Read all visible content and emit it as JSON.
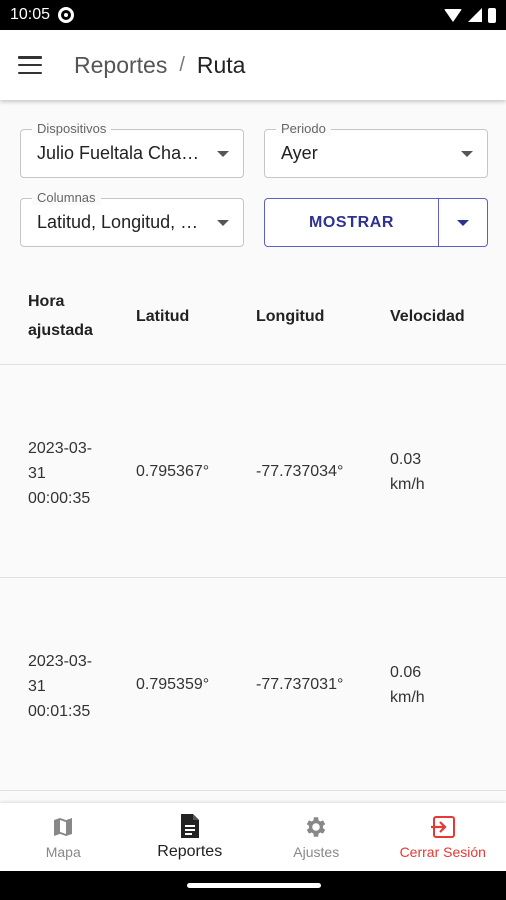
{
  "status_bar": {
    "time": "10:05"
  },
  "breadcrumb": {
    "parent": "Reportes",
    "separator": "/",
    "current": "Ruta"
  },
  "filters": {
    "devices": {
      "label": "Dispositivos",
      "value": "Julio Fueltala Chamorro"
    },
    "period": {
      "label": "Periodo",
      "value": "Ayer"
    },
    "columns": {
      "label": "Columnas",
      "value": "Latitud, Longitud, Velocidad"
    },
    "show_button": "MOSTRAR"
  },
  "table": {
    "headers": [
      "Hora ajustada",
      "Latitud",
      "Longitud",
      "Velocidad"
    ],
    "rows": [
      {
        "time": "2023-03-31 00:00:35",
        "lat": "0.795367°",
        "lon": "-77.737034°",
        "speed": "0.03 km/h"
      },
      {
        "time": "2023-03-31 00:01:35",
        "lat": "0.795359°",
        "lon": "-77.737031°",
        "speed": "0.06 km/h"
      }
    ]
  },
  "bottom_nav": [
    {
      "label": "Mapa",
      "icon": "map-icon"
    },
    {
      "label": "Reportes",
      "icon": "document-icon"
    },
    {
      "label": "Ajustes",
      "icon": "gear-icon"
    },
    {
      "label": "Cerrar Sesión",
      "icon": "logout-icon"
    }
  ],
  "colors": {
    "accent": "#2f3292",
    "danger": "#e53935"
  }
}
